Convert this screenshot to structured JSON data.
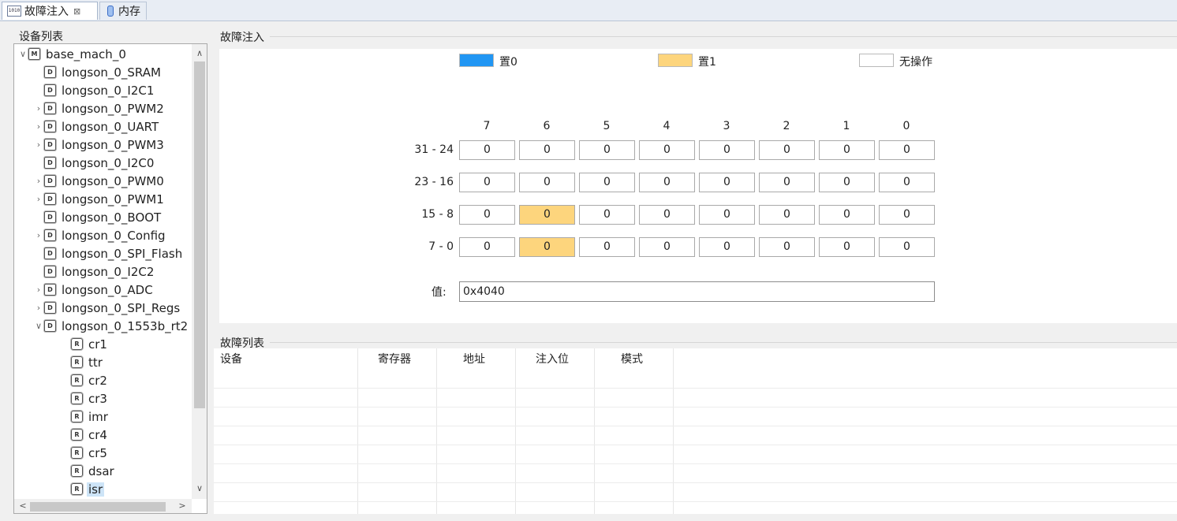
{
  "tabs": [
    {
      "label": "故障注入",
      "icon": "binary-1010-icon",
      "active": true,
      "close": "⊠"
    },
    {
      "label": "内存",
      "icon": "memory-icon",
      "active": false
    }
  ],
  "device_list": {
    "title": "设备列表",
    "items": [
      {
        "label": "base_mach_0",
        "level": 0,
        "toggle": "∨",
        "icon": "M"
      },
      {
        "label": "longson_0_SRAM",
        "level": 1,
        "toggle": "",
        "icon": "D"
      },
      {
        "label": "longson_0_I2C1",
        "level": 1,
        "toggle": "",
        "icon": "D"
      },
      {
        "label": "longson_0_PWM2",
        "level": 1,
        "toggle": "›",
        "icon": "D"
      },
      {
        "label": "longson_0_UART",
        "level": 1,
        "toggle": "›",
        "icon": "D"
      },
      {
        "label": "longson_0_PWM3",
        "level": 1,
        "toggle": "›",
        "icon": "D"
      },
      {
        "label": "longson_0_I2C0",
        "level": 1,
        "toggle": "",
        "icon": "D"
      },
      {
        "label": "longson_0_PWM0",
        "level": 1,
        "toggle": "›",
        "icon": "D"
      },
      {
        "label": "longson_0_PWM1",
        "level": 1,
        "toggle": "›",
        "icon": "D"
      },
      {
        "label": "longson_0_BOOT",
        "level": 1,
        "toggle": "",
        "icon": "D"
      },
      {
        "label": "longson_0_Config",
        "level": 1,
        "toggle": "›",
        "icon": "D"
      },
      {
        "label": "longson_0_SPI_Flash",
        "level": 1,
        "toggle": "",
        "icon": "D"
      },
      {
        "label": "longson_0_I2C2",
        "level": 1,
        "toggle": "",
        "icon": "D"
      },
      {
        "label": "longson_0_ADC",
        "level": 1,
        "toggle": "›",
        "icon": "D"
      },
      {
        "label": "longson_0_SPI_Regs",
        "level": 1,
        "toggle": "›",
        "icon": "D"
      },
      {
        "label": "longson_0_1553b_rt2",
        "level": 1,
        "toggle": "∨",
        "icon": "D"
      },
      {
        "label": "cr1",
        "level": 2,
        "toggle": "",
        "icon": "R"
      },
      {
        "label": "ttr",
        "level": 2,
        "toggle": "",
        "icon": "R"
      },
      {
        "label": "cr2",
        "level": 2,
        "toggle": "",
        "icon": "R"
      },
      {
        "label": "cr3",
        "level": 2,
        "toggle": "",
        "icon": "R"
      },
      {
        "label": "imr",
        "level": 2,
        "toggle": "",
        "icon": "R"
      },
      {
        "label": "cr4",
        "level": 2,
        "toggle": "",
        "icon": "R"
      },
      {
        "label": "cr5",
        "level": 2,
        "toggle": "",
        "icon": "R"
      },
      {
        "label": "dsar",
        "level": 2,
        "toggle": "",
        "icon": "R"
      },
      {
        "label": "isr",
        "level": 2,
        "toggle": "",
        "icon": "R",
        "selected": true
      }
    ],
    "scroll": {
      "up": "∧",
      "down": "∨",
      "left": "<",
      "right": ">"
    }
  },
  "fault_injection": {
    "title": "故障注入",
    "legend": [
      {
        "label": "置0",
        "color": "#2196f3"
      },
      {
        "label": "置1",
        "color": "#fdd57d"
      },
      {
        "label": "无操作",
        "color": "#ffffff"
      }
    ],
    "bit_columns": [
      "7",
      "6",
      "5",
      "4",
      "3",
      "2",
      "1",
      "0"
    ],
    "rows": [
      {
        "label": "31 - 24",
        "bits": [
          "0",
          "0",
          "0",
          "0",
          "0",
          "0",
          "0",
          "0"
        ],
        "modes": [
          "none",
          "none",
          "none",
          "none",
          "none",
          "none",
          "none",
          "none"
        ]
      },
      {
        "label": "23 - 16",
        "bits": [
          "0",
          "0",
          "0",
          "0",
          "0",
          "0",
          "0",
          "0"
        ],
        "modes": [
          "none",
          "none",
          "none",
          "none",
          "none",
          "none",
          "none",
          "none"
        ]
      },
      {
        "label": "15 - 8",
        "bits": [
          "0",
          "0",
          "0",
          "0",
          "0",
          "0",
          "0",
          "0"
        ],
        "modes": [
          "none",
          "set1",
          "none",
          "none",
          "none",
          "none",
          "none",
          "none"
        ]
      },
      {
        "label": "7 - 0",
        "bits": [
          "0",
          "0",
          "0",
          "0",
          "0",
          "0",
          "0",
          "0"
        ],
        "modes": [
          "none",
          "set1",
          "none",
          "none",
          "none",
          "none",
          "none",
          "none"
        ]
      }
    ],
    "value_label": "值:",
    "value": "0x4040"
  },
  "fault_list": {
    "title": "故障列表",
    "columns": [
      "设备",
      "寄存器",
      "地址",
      "注入位",
      "模式"
    ]
  }
}
